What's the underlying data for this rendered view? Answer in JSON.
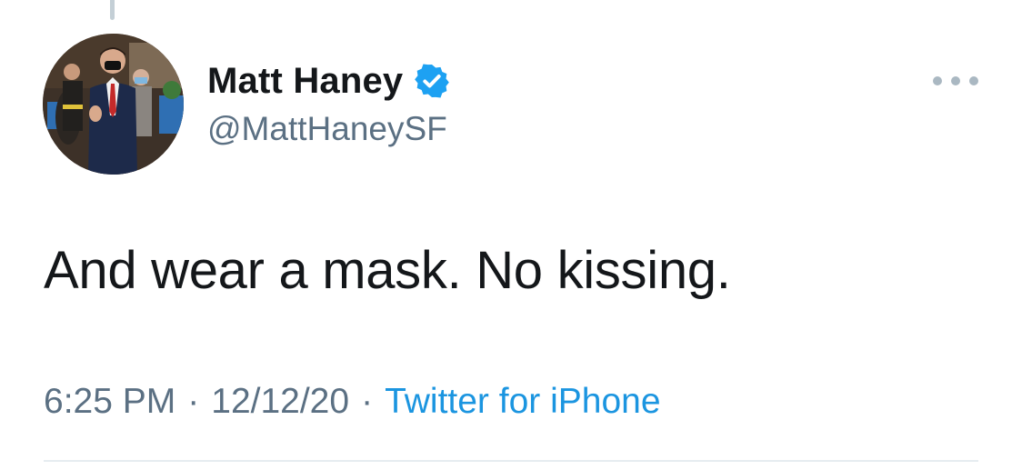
{
  "tweet": {
    "author": {
      "display_name": "Matt Haney",
      "handle": "@MattHaneySF",
      "verified": true,
      "avatar_icon": "profile-photo"
    },
    "text": "And wear a mask. No kissing.",
    "time": "6:25 PM",
    "date": "12/12/20",
    "separator": "·",
    "source": "Twitter for iPhone",
    "more_icon": "ellipsis-icon"
  },
  "colors": {
    "text_primary": "#14171a",
    "text_secondary": "#5b7083",
    "link": "#1b95e0",
    "verified_badge": "#1da1f2",
    "thread_line": "#c4cfd6",
    "divider": "#e6ecf0"
  }
}
